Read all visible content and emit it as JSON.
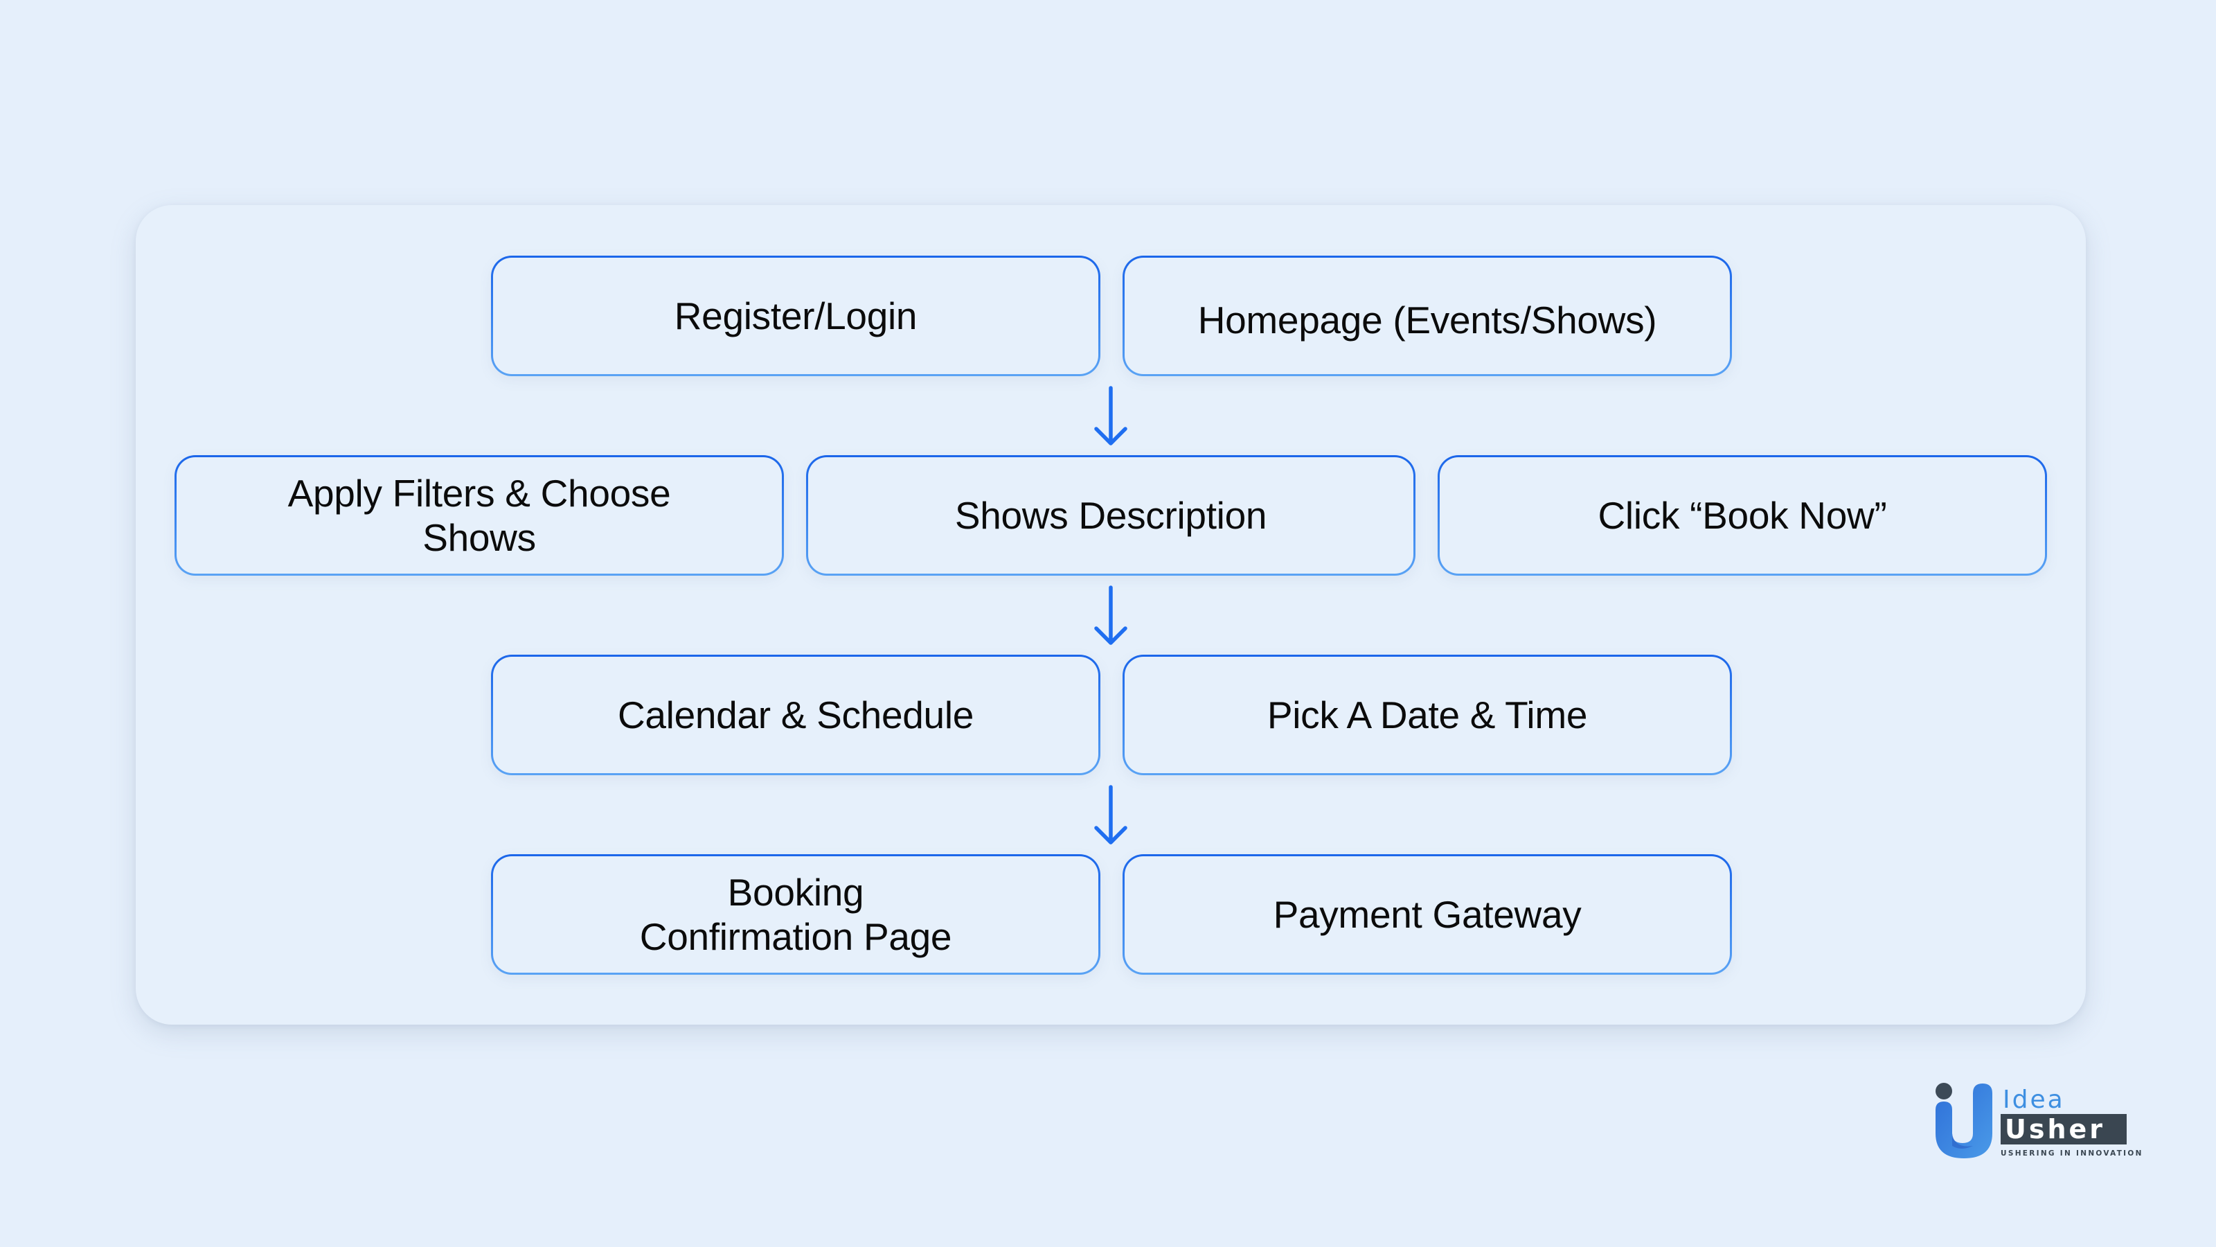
{
  "diagram": {
    "type": "flowchart",
    "rows": [
      {
        "nodes": [
          {
            "label": "Register/Login"
          },
          {
            "label": "Homepage (Events/Shows)"
          }
        ]
      },
      {
        "nodes": [
          {
            "label": "Apply Filters & Choose\nShows"
          },
          {
            "label": "Shows Description"
          },
          {
            "label": "Click “Book Now”"
          }
        ]
      },
      {
        "nodes": [
          {
            "label": "Calendar & Schedule"
          },
          {
            "label": "Pick A Date & Time"
          }
        ]
      },
      {
        "nodes": [
          {
            "label": "Booking\nConfirmation Page"
          },
          {
            "label": "Payment Gateway"
          }
        ]
      }
    ],
    "connectors": [
      {
        "from_row": 1,
        "to_row": 2,
        "icon": "arrow-down-icon"
      },
      {
        "from_row": 2,
        "to_row": 3,
        "icon": "arrow-down-icon"
      },
      {
        "from_row": 3,
        "to_row": 4,
        "icon": "arrow-down-icon"
      }
    ]
  },
  "branding": {
    "logo_word_top": "Idea",
    "logo_word_bottom": "Usher",
    "tagline": "USHERING IN INNOVATION"
  },
  "colors": {
    "background": "#e5effb",
    "card": "#e6f0fb",
    "node_border_top": "#1b66ea",
    "node_border_bottom": "#5aa3f4",
    "arrow": "#1f6ef0",
    "text": "#0b0b0b",
    "logo_blue": "#3e8fe1",
    "logo_dark": "#3a4651"
  }
}
